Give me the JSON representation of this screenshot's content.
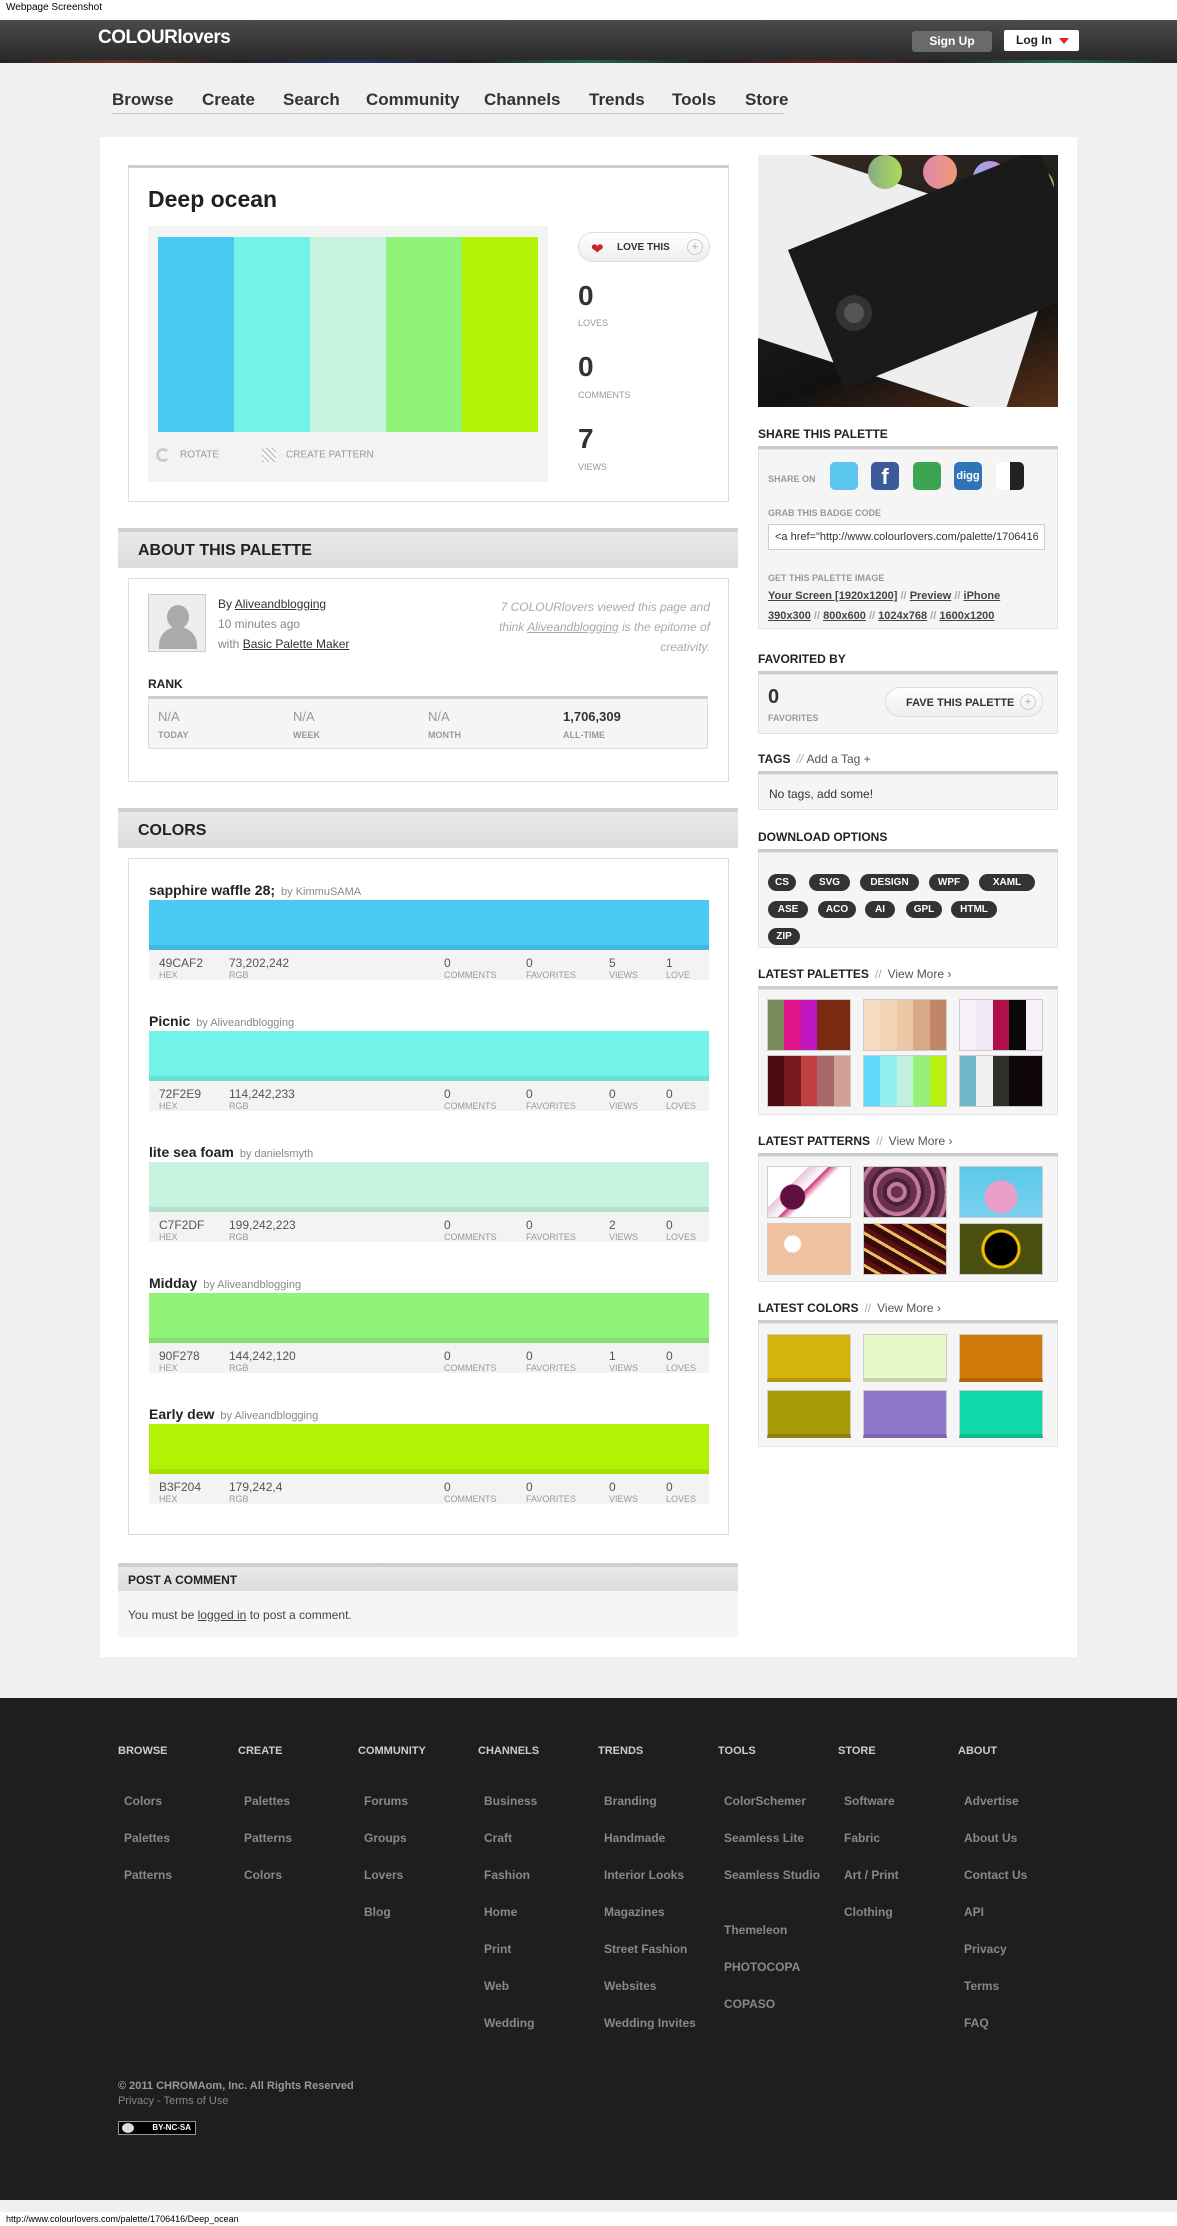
{
  "caption": "Webpage Screenshot",
  "header": {
    "logo": "COLOURlovers",
    "signup": "Sign Up",
    "login": "Log In"
  },
  "nav": [
    "Browse",
    "Create",
    "Search",
    "Community",
    "Channels",
    "Trends",
    "Tools",
    "Store"
  ],
  "palette": {
    "title": "Deep ocean",
    "colors": [
      "#49CAF2",
      "#72F2E9",
      "#C7F2DF",
      "#90F278",
      "#B3F204"
    ],
    "love": "LOVE THIS",
    "loves": "0",
    "loves_label": "LOVES",
    "comments": "0",
    "comments_label": "COMMENTS",
    "views": "7",
    "views_label": "VIEWS",
    "rotate": "ROTATE",
    "create_pattern": "CREATE PATTERN"
  },
  "about": {
    "heading": "ABOUT THIS PALETTE",
    "by_prefix": "By",
    "author": "Aliveandblogging",
    "time": "10 minutes ago",
    "with_prefix": "with",
    "tool": "Basic Palette Maker",
    "quote_pre": "7 COLOURlovers viewed this page and think",
    "quote_author": "Aliveandblogging",
    "quote_post": "is the epitome of creativity.",
    "rank_label": "RANK",
    "ranks": [
      {
        "v": "N/A",
        "l": "TODAY"
      },
      {
        "v": "N/A",
        "l": "WEEK"
      },
      {
        "v": "N/A",
        "l": "MONTH"
      },
      {
        "v": "1,706,309",
        "l": "ALL-TIME"
      }
    ]
  },
  "colors_section": {
    "heading": "COLORS",
    "items": [
      {
        "name": "sapphire waffle 28;",
        "by": "by KimmuSAMA",
        "hex": "49CAF2",
        "rgb": "73,202,242",
        "color": "#49CAF2",
        "comments": "0",
        "favorites": "0",
        "views": "5",
        "loves": "1",
        "loves_label": "LOVE"
      },
      {
        "name": "Picnic",
        "by": "by Aliveandblogging",
        "hex": "72F2E9",
        "rgb": "114,242,233",
        "color": "#72F2E9",
        "comments": "0",
        "favorites": "0",
        "views": "0",
        "loves": "0",
        "loves_label": "LOVES"
      },
      {
        "name": "lite sea foam",
        "by": "by danielsmyth",
        "hex": "C7F2DF",
        "rgb": "199,242,223",
        "color": "#C7F2DF",
        "comments": "0",
        "favorites": "0",
        "views": "2",
        "loves": "0",
        "loves_label": "LOVES"
      },
      {
        "name": "Midday",
        "by": "by Aliveandblogging",
        "hex": "90F278",
        "rgb": "144,242,120",
        "color": "#90F278",
        "comments": "0",
        "favorites": "0",
        "views": "1",
        "loves": "0",
        "loves_label": "LOVES"
      },
      {
        "name": "Early dew",
        "by": "by Aliveandblogging",
        "hex": "B3F204",
        "rgb": "179,242,4",
        "color": "#B3F204",
        "comments": "0",
        "favorites": "0",
        "views": "0",
        "loves": "0",
        "loves_label": "LOVES"
      }
    ],
    "labels": {
      "hex": "HEX",
      "rgb": "RGB",
      "comments": "COMMENTS",
      "favorites": "FAVORITES",
      "views": "VIEWS"
    }
  },
  "comment": {
    "heading": "POST A COMMENT",
    "pre": "You must be",
    "link": "logged in",
    "post": "to post a comment."
  },
  "share": {
    "heading": "SHARE THIS PALETTE",
    "share_on": "SHARE ON",
    "badge_label": "GRAB THIS BADGE CODE",
    "badge_code": "<a href=\"http://www.colourlovers.com/palette/1706416",
    "image_label": "GET THIS PALETTE IMAGE",
    "sizes_line1": [
      "Your Screen [1920x1200]",
      "Preview",
      "iPhone"
    ],
    "sizes_line2": [
      "390x300",
      "800x600",
      "1024x768",
      "1600x1200"
    ]
  },
  "favorited": {
    "heading": "FAVORITED BY",
    "count": "0",
    "label": "FAVORITES",
    "button": "FAVE THIS PALETTE"
  },
  "tags": {
    "heading": "TAGS",
    "add": "Add a Tag +",
    "empty": "No tags, add some!"
  },
  "download": {
    "heading": "DOWNLOAD OPTIONS",
    "row1": [
      "CS",
      "SVG",
      "DESIGN",
      "WPF",
      "XAML"
    ],
    "row2": [
      "ASE",
      "ACO",
      "AI",
      "GPL",
      "HTML"
    ],
    "row3": [
      "ZIP"
    ]
  },
  "latest_palettes": {
    "heading": "LATEST PALETTES",
    "view_more": "View More ›",
    "items": [
      [
        "#7a8a5a",
        "#e0158a",
        "#c018c0",
        "#7a2a10",
        "#7a2a10"
      ],
      [
        "#f5dcc0",
        "#f3d4b5",
        "#ecc7a5",
        "#d9a887",
        "#c0866a"
      ],
      [
        "#f8f0f8",
        "#f0e8f2",
        "#b0104a",
        "#0a0a0a",
        "#f8f0f8"
      ],
      [
        "#4a0a10",
        "#7a1a20",
        "#c04040",
        "#a86868",
        "#d0a098"
      ],
      [
        "#60d8f8",
        "#90f0f0",
        "#c0f0e0",
        "#98f078",
        "#b8f010"
      ],
      [
        "#70b8c8",
        "#f0f0f0",
        "#303028",
        "#100808",
        "#100808"
      ]
    ]
  },
  "latest_patterns": {
    "heading": "LATEST PATTERNS",
    "view_more": "View More ›"
  },
  "latest_colors": {
    "heading": "LATEST COLORS",
    "view_more": "View More ›",
    "items": [
      "#D4B40A",
      "#E8F8C8",
      "#D07808",
      "#A89A08",
      "#9078C8",
      "#10D8A8"
    ]
  },
  "footer": {
    "cols": [
      {
        "h": "BROWSE",
        "links": [
          "Colors",
          "Palettes",
          "Patterns"
        ]
      },
      {
        "h": "CREATE",
        "links": [
          "Palettes",
          "Patterns",
          "Colors"
        ]
      },
      {
        "h": "COMMUNITY",
        "links": [
          "Forums",
          "Groups",
          "Lovers",
          "Blog"
        ]
      },
      {
        "h": "CHANNELS",
        "links": [
          "Business",
          "Craft",
          "Fashion",
          "Home",
          "Print",
          "Web",
          "Wedding"
        ]
      },
      {
        "h": "TRENDS",
        "links": [
          "Branding",
          "Handmade",
          "Interior Looks",
          "Magazines",
          "Street Fashion",
          "Websites",
          "Wedding Invites"
        ]
      },
      {
        "h": "TOOLS",
        "links": [
          "ColorSchemer",
          "Seamless Lite",
          "Seamless Studio",
          "Themeleon",
          "PHOTOCOPA",
          "COPASO"
        ]
      },
      {
        "h": "STORE",
        "links": [
          "Software",
          "Fabric",
          "Art / Print",
          "Clothing"
        ]
      },
      {
        "h": "ABOUT",
        "links": [
          "Advertise",
          "About Us",
          "Contact Us",
          "API",
          "Privacy",
          "Terms",
          "FAQ"
        ]
      }
    ],
    "copyright": "© 2011 CHROMAom, Inc. All Rights Reserved",
    "privacy": "Privacy",
    "terms": "Terms of Use",
    "license": "BY-NC-SA"
  },
  "statusbar": "http://www.colourlovers.com/palette/1706416/Deep_ocean"
}
